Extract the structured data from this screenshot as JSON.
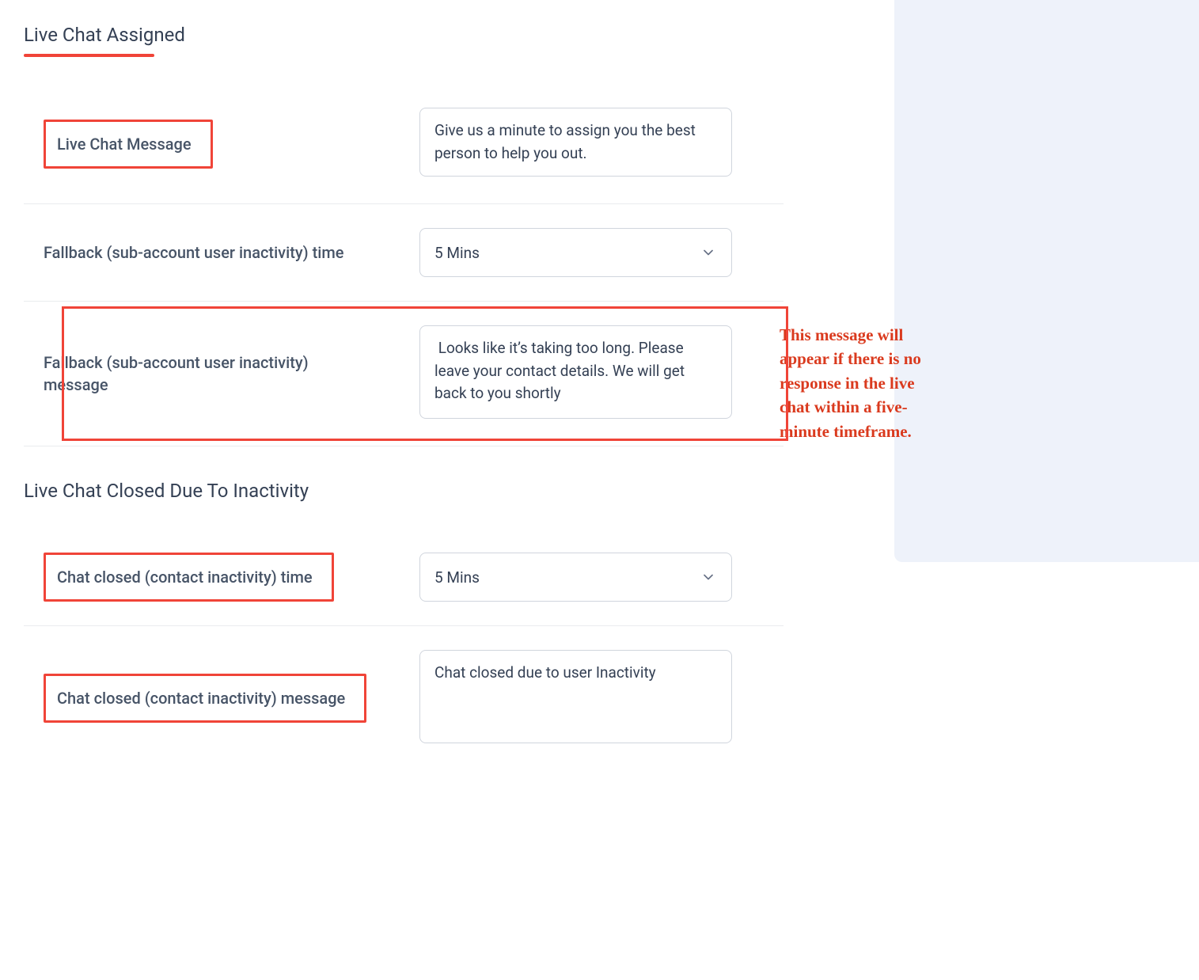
{
  "colors": {
    "accent": "#f04438",
    "annotation": "#da3a1e",
    "border": "#d0d5dd",
    "text_muted": "#475467"
  },
  "sections": {
    "assigned": {
      "heading": "Live Chat Assigned"
    },
    "closed": {
      "heading": "Live Chat Closed Due To Inactivity"
    }
  },
  "fields": {
    "live_chat_message": {
      "label": "Live Chat Message",
      "value": "Give us a minute to assign you the best person to help you out."
    },
    "fallback_time": {
      "label": "Fallback (sub-account user inactivity) time",
      "value": "5 Mins"
    },
    "fallback_message": {
      "label": "Fallback (sub-account user inactivity) message",
      "value": " Looks like it’s taking too long. Please leave your contact details. We will get back to you shortly"
    },
    "closed_time": {
      "label": "Chat closed (contact inactivity) time",
      "value": "5 Mins"
    },
    "closed_message": {
      "label": "Chat closed (contact inactivity) message",
      "value": "Chat closed due to user Inactivity"
    }
  },
  "annotation": "This message will appear if there is no response in the live chat within a five-minute timeframe."
}
